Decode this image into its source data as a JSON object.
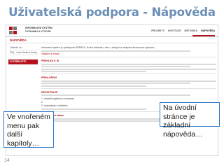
{
  "slide": {
    "title": "Uživatelská podpora - Nápověda",
    "page_number": "14"
  },
  "app": {
    "logo_text_lines": [
      "INFORMAČNÍ SYSTÉM",
      "VÝZKUMU A VÝVOJE"
    ],
    "nav_items": [
      "PROJEKTY",
      "INSTITUCE",
      "METODIKA",
      "NÁPOVĚDA"
    ],
    "active_nav": "NÁPOVĚDA",
    "page_heading": "NÁPOVĚDA",
    "brand_color": "#b5121b"
  },
  "sidebar": {
    "items": [
      "Základní se...",
      "FAQ - často kladené dotazy"
    ],
    "active_item": "POTŘEBUJETE PORADIT?"
  },
  "content": {
    "intro": "Informační systém je zpřístupněn SPRÁVY. Je tiše dohledat v něm o zdrojích a veřejném financování výzkumu...",
    "intro_link": "Základní a dotazy",
    "sections": [
      "PŘEHLED K IS",
      "PŘIHLÁŠENÍ",
      "REGISTRACE",
      "Vyhledávání datam"
    ],
    "register_items": [
      "1. nastavit registraci v zobrazení",
      "2.",
      "3. neobsahuje a dalekého"
    ]
  },
  "callouts": {
    "right": "Na úvodní stránce je základní nápověda…",
    "left": "Ve vnořeném menu pak další kapitoly…"
  }
}
